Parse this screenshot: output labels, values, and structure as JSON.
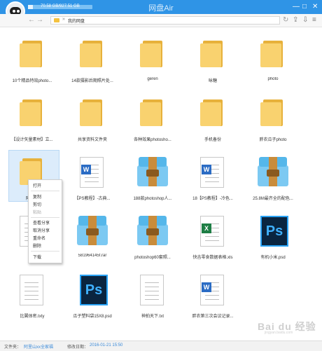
{
  "app": {
    "title": "网盘Air",
    "storage_text": "70.58 GB/927.51 GB",
    "storage_used_fraction": 0.08
  },
  "window_controls": {
    "minimize": "—",
    "maximize": "□",
    "close": "✕"
  },
  "nav": {
    "back": "←",
    "forward": "→",
    "refresh": "↻",
    "separator": "»",
    "breadcrumb": "我的网盘",
    "tools": [
      "⇪",
      "⇩",
      "≡"
    ]
  },
  "rows": [
    [
      {
        "type": "folder",
        "label": "10个精品特效photo..."
      },
      {
        "type": "folder",
        "label": "14款摄影后期照片处..."
      },
      {
        "type": "folder",
        "label": "geren"
      },
      {
        "type": "folder",
        "label": "咏糖"
      },
      {
        "type": "folder",
        "label": "photo"
      }
    ],
    [
      {
        "type": "folder",
        "label": "【设计矢量素材】立..."
      },
      {
        "type": "folder",
        "label": "共享资料文件夹"
      },
      {
        "type": "folder",
        "label": "各种效果photosho..."
      },
      {
        "type": "folder",
        "label": "手机备份"
      },
      {
        "type": "folder",
        "label": "胖农瓜子photo"
      }
    ],
    [
      {
        "type": "folder",
        "label": "阿里山"
      },
      {
        "type": "word",
        "label": "【PS教程】-古典..."
      },
      {
        "type": "rar",
        "label": "188款photoshop人..."
      },
      {
        "type": "word",
        "label": "18【PS教程】-冷色..."
      },
      {
        "type": "rar",
        "label": "25.8M最齐全的配色..."
      }
    ],
    [
      {
        "type": "doc",
        "label": "27..."
      },
      {
        "type": "rar",
        "label": "581964145f.rar"
      },
      {
        "type": "rar",
        "label": "photoshop60套照..."
      },
      {
        "type": "excel",
        "label": "快吉零食数据表格.xls"
      },
      {
        "type": "ps",
        "label": "有机小米.psd"
      }
    ],
    [
      {
        "type": "doc",
        "label": "比翼体密.txty"
      },
      {
        "type": "ps",
        "label": "瓜子塑料袋15X8.psd"
      },
      {
        "type": "doc",
        "label": "神拍天下.txt"
      },
      {
        "type": "word",
        "label": "胖农第三次会议记录..."
      }
    ]
  ],
  "icons": {
    "word": "W",
    "excel": "X",
    "ps": "Ps"
  },
  "context_menu": {
    "items": [
      {
        "label": "打开",
        "enabled": true
      },
      {
        "label": "复制",
        "enabled": true
      },
      {
        "label": "剪切",
        "enabled": true
      },
      {
        "label": "粘贴",
        "enabled": false
      },
      {
        "label": "查看分享",
        "enabled": true
      },
      {
        "label": "取消分享",
        "enabled": true
      },
      {
        "label": "重命名",
        "enabled": true
      },
      {
        "label": "删除",
        "enabled": true
      },
      {
        "label": "下载",
        "enabled": true
      }
    ]
  },
  "status": {
    "file_label": "文件夹：",
    "file_value": "阿里山xx全家福",
    "time_label": "修改日期：",
    "time_value": "2016-01-21  15:50"
  },
  "watermark": {
    "text": "Bai du 经验",
    "sub": "jingyan.baidu.com"
  },
  "colors": {
    "accent": "#2f94e6",
    "folder": "#f9d26f",
    "word": "#2b6cc4",
    "excel": "#1e7e45",
    "ps": "#0a2540"
  }
}
